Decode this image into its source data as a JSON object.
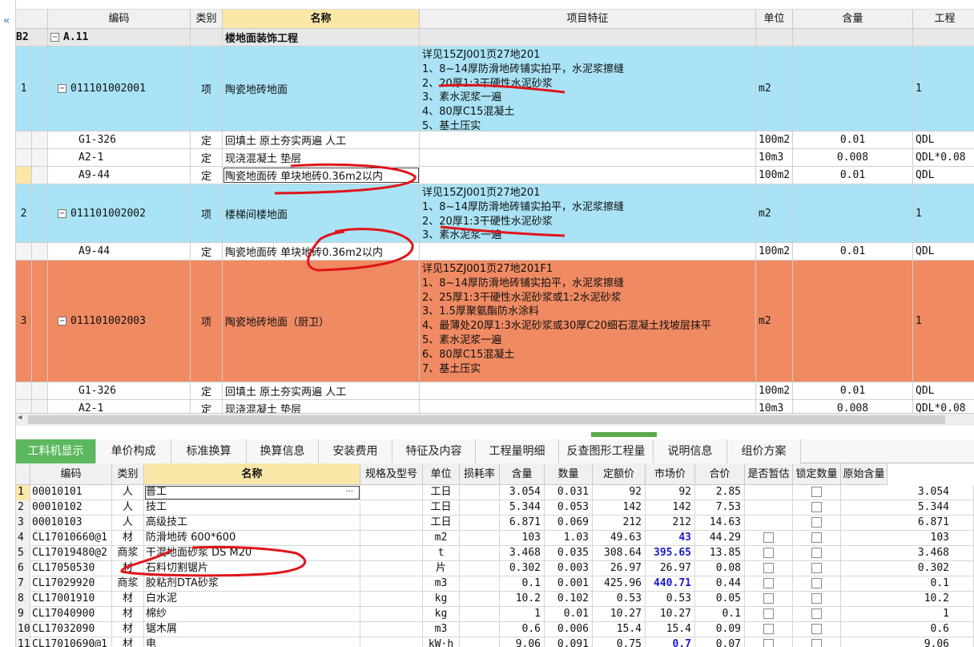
{
  "top_headers": [
    "编码",
    "类别",
    "名称",
    "项目特征",
    "单位",
    "含量",
    "工程"
  ],
  "rows": [
    {
      "num": "B2",
      "code": "A.11",
      "type": "",
      "name": "楼地面装饰工程",
      "feature": "",
      "unit": "",
      "qty": "",
      "expr": ""
    },
    {
      "num": "1",
      "code": "011101002001",
      "type": "项",
      "name": "陶瓷地砖地面",
      "feature": "详见15ZJ001页27地201\n1、8~14厚防滑地砖铺实拍平，水泥浆擦缝\n2、20厚1:3干硬性水泥砂浆\n3、素水泥浆一遍\n4、80厚C15混凝土\n5、基土压实",
      "unit": "m2",
      "qty": "",
      "expr": "1"
    },
    {
      "num": "",
      "code": "G1-326",
      "type": "定",
      "name": "回填土 原土夯实两遍 人工",
      "feature": "",
      "unit": "100m2",
      "qty": "0.01",
      "expr": "QDL"
    },
    {
      "num": "",
      "code": "A2-1",
      "type": "定",
      "name": "现浇混凝土 垫层",
      "feature": "",
      "unit": "10m3",
      "qty": "0.008",
      "expr": "QDL*0.08"
    },
    {
      "num": "",
      "code": "A9-44",
      "type": "定",
      "name": "陶瓷地面砖 单块地砖0.36m2以内",
      "feature": "",
      "unit": "100m2",
      "qty": "0.01",
      "expr": "QDL"
    },
    {
      "num": "2",
      "code": "011101002002",
      "type": "项",
      "name": "楼梯间楼地面",
      "feature": "详见15ZJ001页27地201\n1、8~14厚防滑地砖铺实拍平，水泥浆擦缝\n2、20厚1:3干硬性水泥砂浆\n3、素水泥浆一遍",
      "unit": "m2",
      "qty": "",
      "expr": "1"
    },
    {
      "num": "",
      "code": "A9-44",
      "type": "定",
      "name": "陶瓷地面砖 单块地砖0.36m2以内",
      "feature": "",
      "unit": "100m2",
      "qty": "0.01",
      "expr": "QDL"
    },
    {
      "num": "3",
      "code": "011101002003",
      "type": "项",
      "name": "陶瓷地砖地面（厨卫）",
      "feature": "详见15ZJ001页27地201F1\n1、8~14厚防滑地砖铺实拍平，水泥浆擦缝\n2、25厚1:3干硬性水泥砂浆或1:2水泥砂浆\n3、1.5厚聚氨酯防水涂料\n4、最薄处20厚1:3水泥砂浆或30厚C20细石混凝土找坡层抹平\n5、素水泥浆一遍\n6、80厚C15混凝土\n7、基土压实",
      "unit": "m2",
      "qty": "",
      "expr": "1"
    },
    {
      "num": "",
      "code": "G1-326",
      "type": "定",
      "name": "回填土 原土夯实两遍 人工",
      "feature": "",
      "unit": "100m2",
      "qty": "0.01",
      "expr": "QDL"
    },
    {
      "num": "",
      "code": "A2-1",
      "type": "定",
      "name": "现浇混凝土 垫层",
      "feature": "",
      "unit": "10m3",
      "qty": "0.008",
      "expr": "QDL*0.08"
    }
  ],
  "tabs": [
    "工料机显示",
    "单价构成",
    "标准换算",
    "换算信息",
    "安装费用",
    "特征及内容",
    "工程量明细",
    "反查图形工程量",
    "说明信息",
    "组价方案"
  ],
  "bottom_headers": [
    "编码",
    "类别",
    "名称",
    "规格及型号",
    "单位",
    "损耗率",
    "含量",
    "数量",
    "定额价",
    "市场价",
    "合价",
    "是否暂估",
    "锁定数量",
    "原始含量"
  ],
  "materials": [
    {
      "n": "1",
      "code": "00010101",
      "type": "人",
      "name": "普工",
      "spec": "",
      "unit": "工日",
      "loss": "",
      "qty": "3.054",
      "amount": "0.031",
      "price": "92",
      "market": "92",
      "total": "2.85",
      "orig": "3.054",
      "blue": false,
      "est": false,
      "lock": true
    },
    {
      "n": "2",
      "code": "00010102",
      "type": "人",
      "name": "技工",
      "spec": "",
      "unit": "工日",
      "loss": "",
      "qty": "5.344",
      "amount": "0.053",
      "price": "142",
      "market": "142",
      "total": "7.53",
      "orig": "5.344",
      "blue": false,
      "est": false,
      "lock": true
    },
    {
      "n": "3",
      "code": "00010103",
      "type": "人",
      "name": "高级技工",
      "spec": "",
      "unit": "工日",
      "loss": "",
      "qty": "6.871",
      "amount": "0.069",
      "price": "212",
      "market": "212",
      "total": "14.63",
      "orig": "6.871",
      "blue": false,
      "est": false,
      "lock": true
    },
    {
      "n": "4",
      "code": "CL17010660@1",
      "type": "材",
      "name": "防滑地砖 600*600",
      "spec": "",
      "unit": "m2",
      "loss": "",
      "qty": "103",
      "amount": "1.03",
      "price": "49.63",
      "market": "43",
      "total": "44.29",
      "orig": "103",
      "blue": true,
      "est": true,
      "lock": true
    },
    {
      "n": "5",
      "code": "CL17019480@2",
      "type": "商浆",
      "name": "干混地面砂浆 DS M20",
      "spec": "",
      "unit": "t",
      "loss": "",
      "qty": "3.468",
      "amount": "0.035",
      "price": "308.64",
      "market": "395.65",
      "total": "13.85",
      "orig": "3.468",
      "blue": true,
      "est": true,
      "lock": true
    },
    {
      "n": "6",
      "code": "CL17050530",
      "type": "材",
      "name": "石料切割锯片",
      "spec": "",
      "unit": "片",
      "loss": "",
      "qty": "0.302",
      "amount": "0.003",
      "price": "26.97",
      "market": "26.97",
      "total": "0.08",
      "orig": "0.302",
      "blue": false,
      "est": true,
      "lock": true
    },
    {
      "n": "7",
      "code": "CL17029920",
      "type": "商浆",
      "name": "胶粘剂DTA砂浆",
      "spec": "",
      "unit": "m3",
      "loss": "",
      "qty": "0.1",
      "amount": "0.001",
      "price": "425.96",
      "market": "440.71",
      "total": "0.44",
      "orig": "0.1",
      "blue": true,
      "est": true,
      "lock": true
    },
    {
      "n": "8",
      "code": "CL17001910",
      "type": "材",
      "name": "白水泥",
      "spec": "",
      "unit": "kg",
      "loss": "",
      "qty": "10.2",
      "amount": "0.102",
      "price": "0.53",
      "market": "0.53",
      "total": "0.05",
      "orig": "10.2",
      "blue": false,
      "est": true,
      "lock": true
    },
    {
      "n": "9",
      "code": "CL17040900",
      "type": "材",
      "name": "棉纱",
      "spec": "",
      "unit": "kg",
      "loss": "",
      "qty": "1",
      "amount": "0.01",
      "price": "10.27",
      "market": "10.27",
      "total": "0.1",
      "orig": "1",
      "blue": false,
      "est": true,
      "lock": true
    },
    {
      "n": "10",
      "code": "CL17032090",
      "type": "材",
      "name": "锯木屑",
      "spec": "",
      "unit": "m3",
      "loss": "",
      "qty": "0.6",
      "amount": "0.006",
      "price": "15.4",
      "market": "15.4",
      "total": "0.09",
      "orig": "0.6",
      "blue": false,
      "est": true,
      "lock": true
    },
    {
      "n": "11",
      "code": "CL17010690@1",
      "type": "材",
      "name": "电",
      "spec": "",
      "unit": "kW·h",
      "loss": "",
      "qty": "9.06",
      "amount": "0.091",
      "price": "0.75",
      "market": "0.7",
      "total": "0.07",
      "orig": "9.06",
      "blue": true,
      "est": true,
      "lock": true
    }
  ],
  "name_cell_ellipsis": "···",
  "left_arrow": "«",
  "colors": {
    "blue_row": "#a9e3f5",
    "orange_row": "#f08a62",
    "header": "#f0f0f0",
    "selected_header": "#fbe8a8",
    "tab_active": "#5cb85c",
    "annotation": "#e0141a"
  }
}
